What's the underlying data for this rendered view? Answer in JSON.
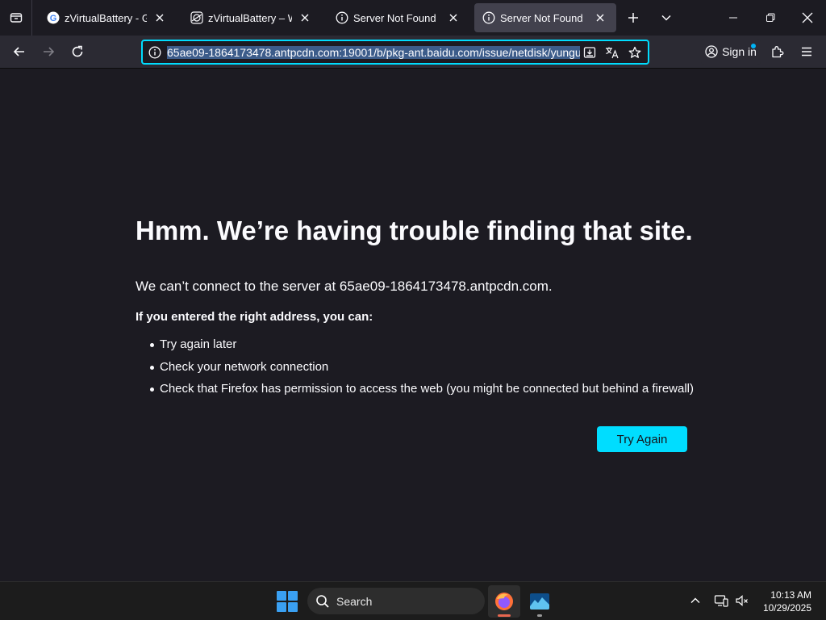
{
  "browser": {
    "tabs": [
      {
        "title": "zVirtualBattery - Google",
        "favicon": "google-icon",
        "active": false
      },
      {
        "title": "zVirtualBattery – WWW",
        "favicon": "globe-icon",
        "active": false
      },
      {
        "title": "Server Not Found",
        "favicon": "info-icon",
        "active": false
      },
      {
        "title": "Server Not Found",
        "favicon": "info-icon",
        "active": true
      }
    ],
    "url": "65ae09-1864173478.antpcdn.com:19001/b/pkg-ant.baidu.com/issue/netdisk/yungu",
    "signin_label": "Sign in"
  },
  "error_page": {
    "title": "Hmm. We’re having trouble finding that site.",
    "description": "We can’t connect to the server at 65ae09-1864173478.antpcdn.com.",
    "subtitle": "If you entered the right address, you can:",
    "suggestions": [
      "Try again later",
      "Check your network connection",
      "Check that Firefox has permission to access the web (you might be connected but behind a firewall)"
    ],
    "button_label": "Try Again"
  },
  "taskbar": {
    "search_placeholder": "Search",
    "time": "10:13 AM",
    "date": "10/29/2025"
  },
  "colors": {
    "accent": "#00ddff",
    "background": "#1c1b22",
    "toolbar": "#2b2a33"
  }
}
